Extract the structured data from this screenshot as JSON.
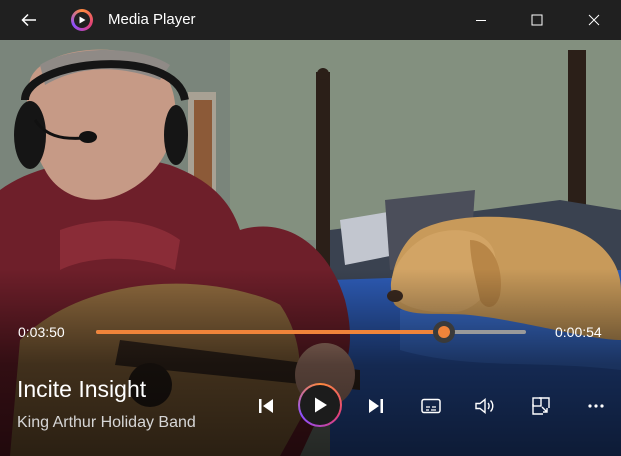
{
  "window": {
    "title": "Media Player",
    "icons": {
      "back": "back-arrow-icon",
      "app": "media-player-logo-icon",
      "minimize": "minimize-icon",
      "maximize": "maximize-icon",
      "close": "close-icon"
    }
  },
  "playback": {
    "elapsed": "0:03:50",
    "remaining": "0:00:54",
    "progress_fraction": 0.81,
    "accent_color": "#f0843a"
  },
  "track": {
    "title": "Incite Insight",
    "artist": "King Arthur Holiday Band"
  },
  "controls": {
    "icons": [
      "previous-icon",
      "play-icon",
      "next-icon",
      "subtitles-icon",
      "volume-icon",
      "mini-player-icon",
      "more-icon"
    ]
  }
}
